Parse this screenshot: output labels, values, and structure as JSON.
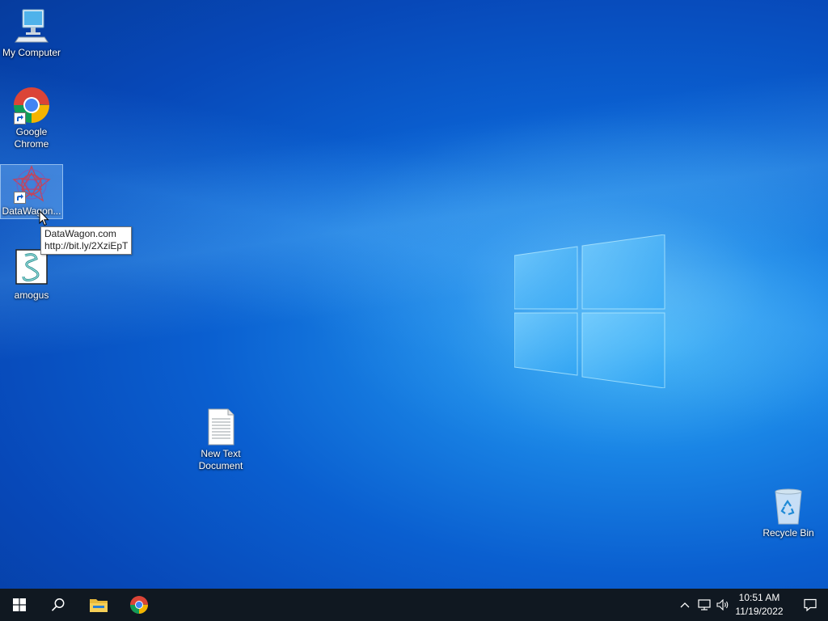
{
  "desktop": {
    "icons": [
      {
        "label": "My Computer"
      },
      {
        "label": "Google Chrome"
      },
      {
        "label": "DataWagon...",
        "selected": true
      },
      {
        "label": "amogus"
      },
      {
        "label": "New Text Document"
      },
      {
        "label": "Recycle Bin"
      }
    ],
    "tooltip": {
      "line1": "DataWagon.com",
      "line2": "http://bit.ly/2XziEpT"
    }
  },
  "taskbar": {
    "pinned": [
      "start-icon",
      "search-icon",
      "file-explorer-icon",
      "chrome-icon"
    ],
    "tray": [
      "chevron-up-icon",
      "network-icon",
      "volume-icon"
    ],
    "clock": {
      "time": "10:51 AM",
      "date": "11/19/2022"
    },
    "background": "#101821"
  },
  "colors": {
    "desktop": "#0a5fd0",
    "accent": "#2aa0f0"
  }
}
